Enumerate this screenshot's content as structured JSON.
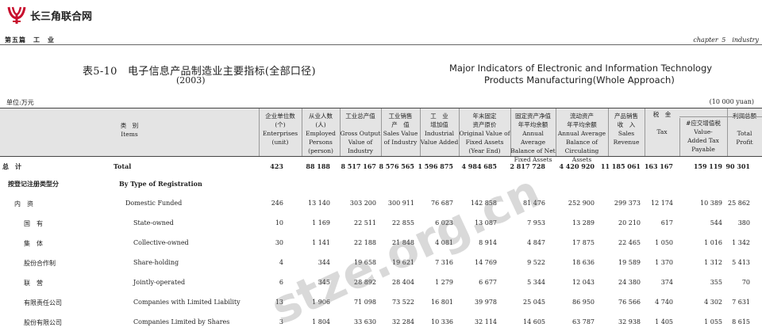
{
  "logo": {
    "text": "长三角联合网",
    "color": "#c8102e"
  },
  "header": {
    "left": "第五篇　工　业",
    "right": "chapter 5　industry"
  },
  "title": {
    "cn": "表5-10　电子信息产品制造业主要指标(全部口径)",
    "cn_year": "(2003)",
    "en_line1": "Major Indicators of Electronic and Information Technology",
    "en_line2": "Products Manufacturing(Whole Approach)"
  },
  "unit": {
    "left": "单位:万元",
    "right": "(10 000 yuan)"
  },
  "columns": [
    {
      "lines": [
        "类　别",
        "Items"
      ]
    },
    {
      "lines": [
        "企业单位数",
        "(个)",
        "Enterprises",
        "(unit)"
      ]
    },
    {
      "lines": [
        "从业人数",
        "(人)",
        "Employed",
        "Persons",
        "(person)"
      ]
    },
    {
      "lines": [
        "工业总产值",
        "",
        "Gross Output",
        "Value of",
        "Industry"
      ]
    },
    {
      "lines": [
        "工业销售",
        "产　值",
        "Sales Value",
        "of Industry"
      ]
    },
    {
      "lines": [
        "工　业",
        "增加值",
        "Industrial",
        "Value Added"
      ]
    },
    {
      "lines": [
        "年末固定",
        "资产原价",
        "Original Value of",
        "Fixed Assets",
        "(Year End)"
      ]
    },
    {
      "lines": [
        "固定资产净值",
        "年平均余额",
        "Annual Average",
        "Balance of Net",
        "Fixed Assets"
      ]
    },
    {
      "lines": [
        "流动资产",
        "年平均余额",
        "Annual Average",
        "Balance of",
        "Circulating Assets"
      ]
    },
    {
      "lines": [
        "产品销售",
        "收　入",
        "Sales",
        "Revenue"
      ]
    },
    {
      "lines": [
        "税　金",
        "",
        "Tax"
      ]
    },
    {
      "lines": [
        "#应交增值税",
        "Value-",
        "Added Tax",
        "Payable"
      ]
    },
    {
      "lines": [
        "利润总额",
        "",
        "Total",
        "Profit"
      ]
    }
  ],
  "rows": [
    {
      "cn": "总　计",
      "en": "Total",
      "bold": true,
      "values": [
        "423",
        "88 188",
        "8 517 167",
        "8 576 565",
        "1 596 875",
        "4 984 685",
        "2 817 728",
        "4 420 920",
        "11 185 061",
        "163 167",
        "159 119",
        "90 301"
      ]
    },
    {
      "cn": "按登记注册类型分",
      "en": "By Type of Registration",
      "bold": true,
      "values": []
    },
    {
      "cn": "内　资",
      "en": "Domestic Funded",
      "bold": false,
      "values": [
        "246",
        "13 140",
        "303 200",
        "300 911",
        "76 687",
        "142 858",
        "81 476",
        "252 900",
        "299 373",
        "12 174",
        "10 389",
        "25 862"
      ]
    },
    {
      "cn": "国　有",
      "en": "State-owned",
      "bold": false,
      "values": [
        "10",
        "1 169",
        "22 511",
        "22 855",
        "6 023",
        "13 087",
        "7 953",
        "13 289",
        "20 210",
        "617",
        "544",
        "380"
      ]
    },
    {
      "cn": "集　体",
      "en": "Collective-owned",
      "bold": false,
      "values": [
        "30",
        "1 141",
        "22 188",
        "21 848",
        "4 081",
        "8 914",
        "4 847",
        "17 875",
        "22 465",
        "1 050",
        "1 016",
        "1 342"
      ]
    },
    {
      "cn": "股份合作制",
      "en": "Share-holding",
      "bold": false,
      "values": [
        "4",
        "344",
        "19 658",
        "19 621",
        "7 316",
        "14 769",
        "9 522",
        "18 636",
        "19 589",
        "1 370",
        "1 312",
        "5 413"
      ]
    },
    {
      "cn": "联　营",
      "en": "Jointly-operated",
      "bold": false,
      "values": [
        "6",
        "345",
        "28 892",
        "28 404",
        "1 279",
        "6 677",
        "5 344",
        "12 043",
        "24 380",
        "374",
        "355",
        "70"
      ]
    },
    {
      "cn": "有限责任公司",
      "en": "Companies with Limited Liability",
      "bold": false,
      "values": [
        "13",
        "1 906",
        "71 098",
        "73 522",
        "16 801",
        "39 978",
        "25 045",
        "86 950",
        "76 566",
        "4 740",
        "4 302",
        "7 631"
      ]
    },
    {
      "cn": "股份有限公司",
      "en": "Companies Limited by Shares",
      "bold": false,
      "values": [
        "3",
        "1 804",
        "33 630",
        "32 284",
        "10 336",
        "32 114",
        "14 605",
        "63 787",
        "32 938",
        "1 405",
        "1 055",
        "8 615"
      ]
    }
  ],
  "watermark": "stze.org.cn"
}
